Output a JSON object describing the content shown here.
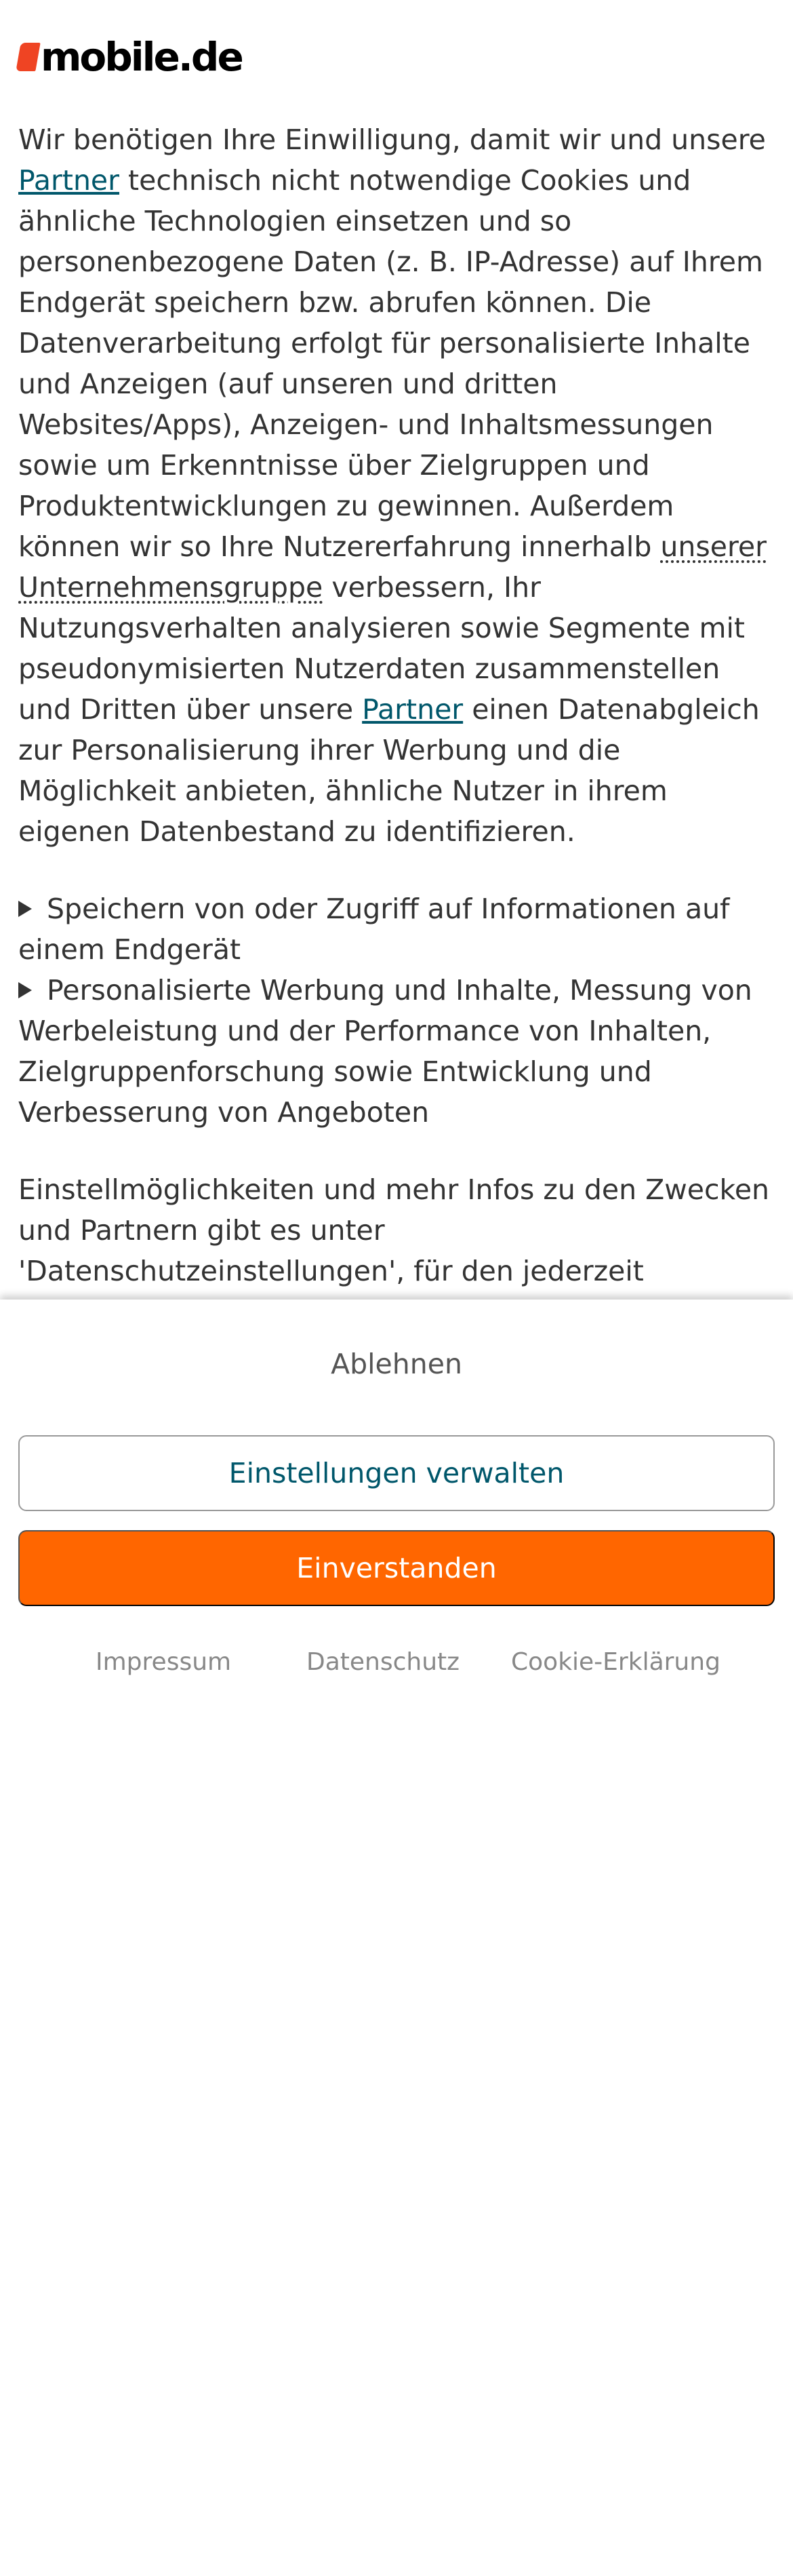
{
  "brand": {
    "logo_text": "mobile.de",
    "accent_color": "#ef4423"
  },
  "consent": {
    "intro": {
      "t1": "Wir benötigen Ihre Einwilligung, damit wir und unsere ",
      "link1": "Partner",
      "t2": " technisch nicht notwendige Cookies und ähnliche Technologien einsetzen und so personenbezogene Daten (z. B. IP-Adresse) auf Ihrem Endgerät speichern bzw. abrufen können. Die Datenverarbeitung erfolgt für personalisierte Inhalte und Anzeigen (auf unseren und dritten Websites/Apps), Anzeigen- und Inhaltsmessungen sowie um Erkenntnisse über Zielgruppen und Produktentwicklungen zu gewinnen. Außerdem können wir so Ihre Nutzererfahrung innerhalb ",
      "group": "unserer Unternehmensgruppe",
      "t3": " verbessern, Ihr Nutzungsverhalten analysieren sowie Segmente mit pseudonymisierten Nutzerdaten zusammenstellen und Dritten über unsere ",
      "link2": "Partner",
      "t4": " einen Datenabgleich zur Personalisierung ihrer Werbung und die Möglichkeit anbieten, ähnliche Nutzer in ihrem eigenen Datenbestand zu identifizieren."
    },
    "purposes": [
      "Speichern von oder Zugriff auf Informationen auf einem Endgerät",
      "Personalisierte Werbung und Inhalte, Messung von Werbeleistung und der Performance von Inhalten, Zielgruppenforschung sowie Entwicklung und Verbesserung von Angeboten"
    ],
    "outro": "Einstellmöglichkeiten und mehr Infos zu den Zwecken und Partnern gibt es unter 'Datenschutzeinstellungen', für den jederzeit möglichen Widerruf der Einwilligung oder nicht"
  },
  "buttons": {
    "reject": "Ablehnen",
    "settings": "Einstellungen verwalten",
    "accept": "Einverstanden",
    "accept_color": "#ff6600"
  },
  "footer_links": [
    "Impressum",
    "Datenschutz",
    "Cookie-Erklärung"
  ]
}
